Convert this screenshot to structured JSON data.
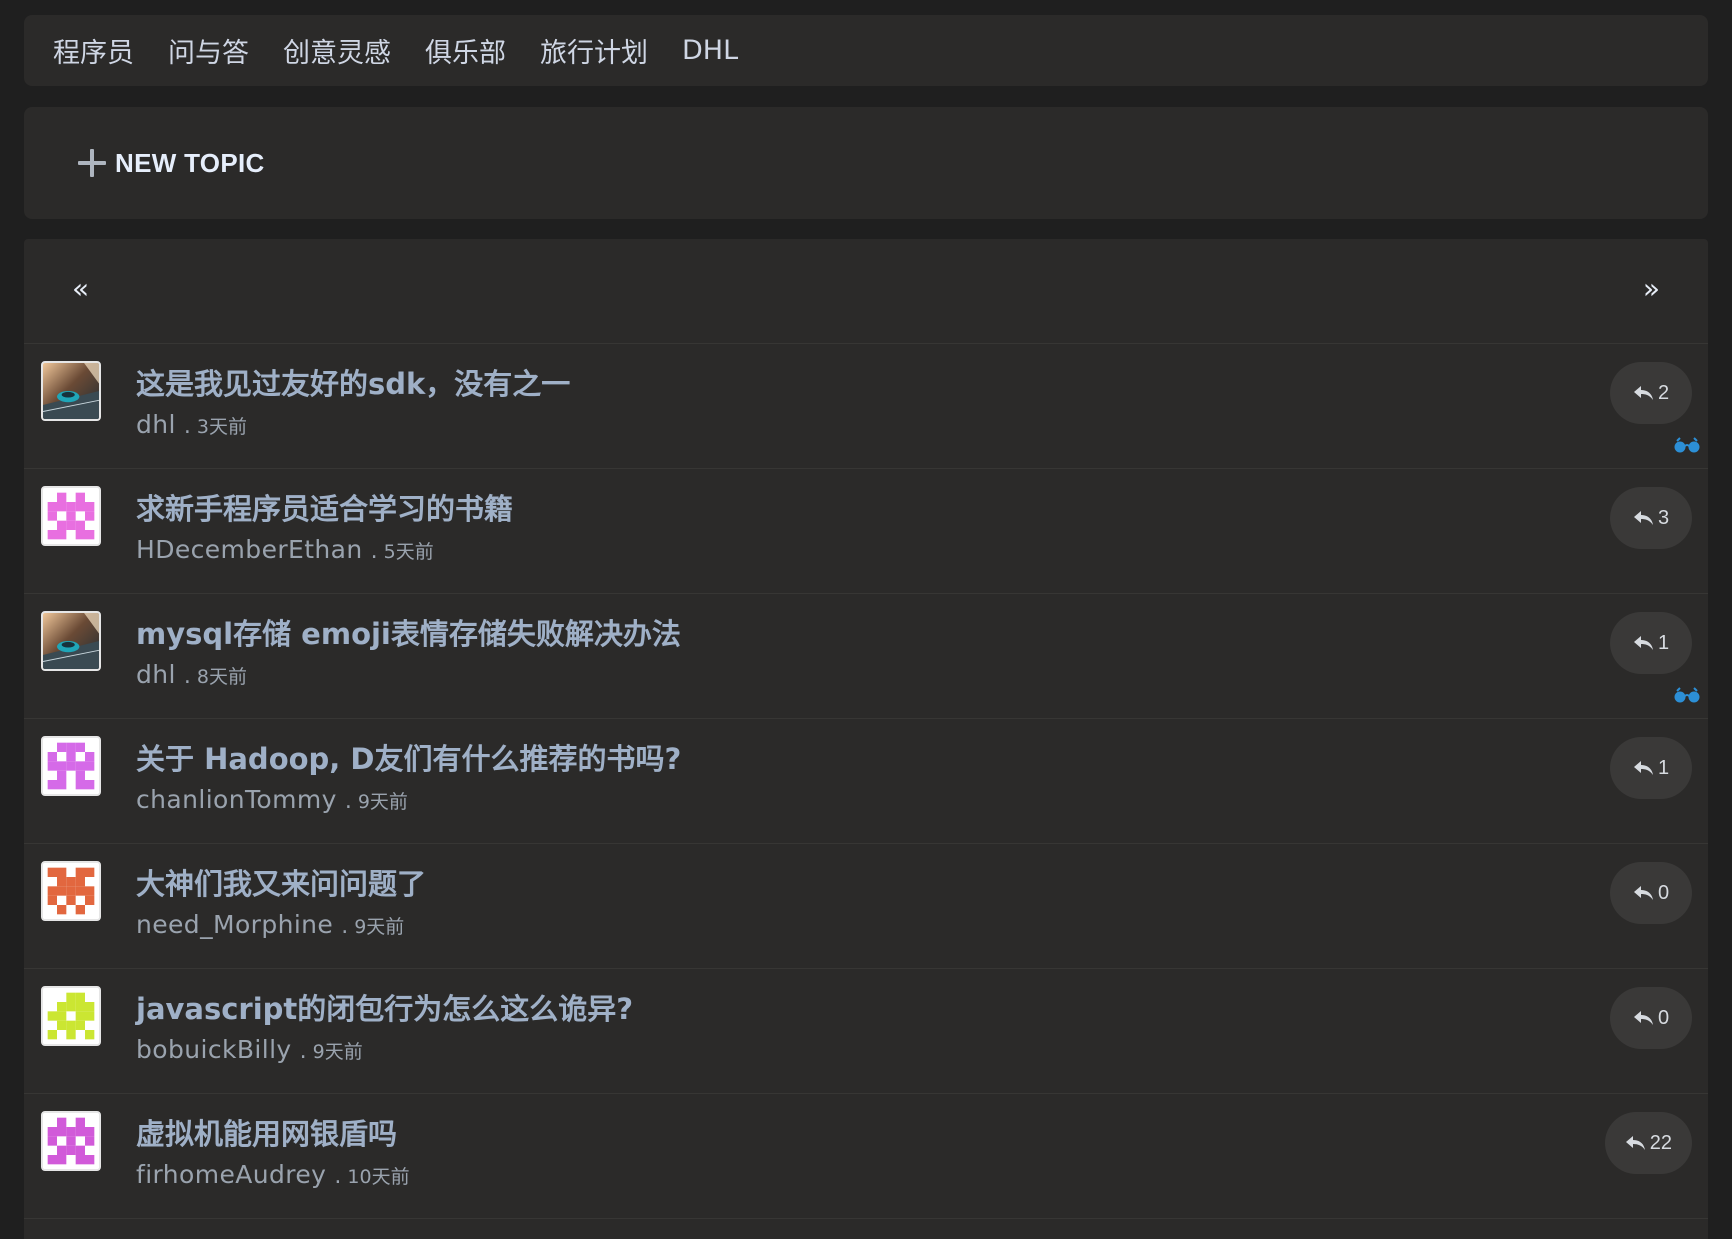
{
  "nav": {
    "items": [
      "程序员",
      "问与答",
      "创意灵感",
      "俱乐部",
      "旅行计划",
      "DHL"
    ]
  },
  "new_topic": {
    "label": "NEW TOPIC",
    "icon": "plus-icon"
  },
  "pager": {
    "prev": "«",
    "next": "»"
  },
  "topics": [
    {
      "title": "这是我见过友好的sdk，没有之一",
      "author": "dhl",
      "sep": ".",
      "time": "3天前",
      "replies": "2",
      "watched": true,
      "avatar": "photo",
      "avatar_color": ""
    },
    {
      "title": "求新手程序员适合学习的书籍",
      "author": "HDecemberEthan",
      "sep": ".",
      "time": "5天前",
      "replies": "3",
      "watched": false,
      "avatar": "identicon",
      "avatar_color": "#e86fe0"
    },
    {
      "title": "mysql存储 emoji表情存储失败解决办法",
      "author": "dhl",
      "sep": ".",
      "time": "8天前",
      "replies": "1",
      "watched": true,
      "avatar": "photo",
      "avatar_color": ""
    },
    {
      "title": "关于 Hadoop, D友们有什么推荐的书吗?",
      "author": "chanlionTommy",
      "sep": ".",
      "time": "9天前",
      "replies": "1",
      "watched": false,
      "avatar": "identicon",
      "avatar_color": "#d56ae8"
    },
    {
      "title": "大神们我又来问问题了",
      "author": "need_Morphine",
      "sep": ".",
      "time": "9天前",
      "replies": "0",
      "watched": false,
      "avatar": "identicon",
      "avatar_color": "#e2673f"
    },
    {
      "title": "javascript的闭包行为怎么这么诡异?",
      "author": "bobuickBilly",
      "sep": ".",
      "time": "9天前",
      "replies": "0",
      "watched": false,
      "avatar": "identicon",
      "avatar_color": "#cbe632"
    },
    {
      "title": "虚拟机能用网银盾吗",
      "author": "firhomeAudrey",
      "sep": ".",
      "time": "10天前",
      "replies": "22",
      "watched": false,
      "avatar": "identicon",
      "avatar_color": "#d15ad9"
    }
  ],
  "colors": {
    "background": "#1f1f1f",
    "card": "#2b2a29",
    "title": "#9fb0c7",
    "pill": "#3a3938",
    "watch_icon": "#2c8fd6"
  }
}
